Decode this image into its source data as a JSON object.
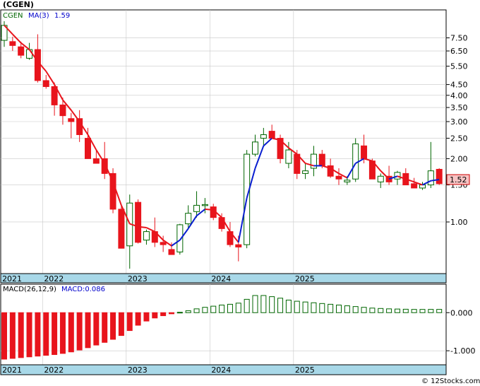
{
  "chart_data": [
    {
      "type": "candlestick",
      "title": "(CGEN)",
      "ticker_label": "CGEN",
      "ma_label": "MA(3)",
      "ma_value": "1.59",
      "last_price": "1.52",
      "y_scale": "log",
      "ylim": [
        0.6,
        9.0
      ],
      "y_ticks": [
        7.5,
        6.5,
        5.5,
        4.5,
        4.0,
        3.5,
        3.0,
        2.5,
        2.0,
        1.5,
        1.0
      ],
      "y_tick_labels": [
        "7.50",
        "6.50",
        "5.50",
        "4.50",
        "4.00",
        "3.50",
        "3.00",
        "2.50",
        "2.00",
        "1.50",
        "1.00"
      ],
      "x_labels": [
        "2021",
        "2022",
        "2023",
        "2024",
        "2025"
      ],
      "x_label_index": [
        0,
        5,
        15,
        25,
        35
      ],
      "ohlc": [
        [
          7.3,
          9.0,
          6.8,
          8.6
        ],
        [
          7.2,
          7.6,
          6.5,
          6.9
        ],
        [
          6.8,
          7.2,
          6.0,
          6.2
        ],
        [
          6.0,
          7.1,
          5.9,
          6.6
        ],
        [
          6.6,
          7.8,
          4.6,
          4.7
        ],
        [
          4.7,
          5.0,
          4.3,
          4.4
        ],
        [
          4.4,
          4.6,
          3.2,
          3.6
        ],
        [
          3.6,
          3.9,
          2.9,
          3.2
        ],
        [
          3.1,
          3.3,
          2.5,
          3.0
        ],
        [
          3.1,
          3.4,
          2.4,
          2.6
        ],
        [
          2.5,
          2.8,
          2.0,
          2.0
        ],
        [
          2.0,
          2.2,
          1.9,
          1.9
        ],
        [
          2.0,
          2.4,
          1.6,
          1.7
        ],
        [
          1.7,
          1.8,
          1.1,
          1.15
        ],
        [
          1.15,
          1.2,
          0.75,
          0.75
        ],
        [
          0.77,
          1.35,
          0.6,
          1.23
        ],
        [
          1.24,
          1.28,
          0.79,
          0.8
        ],
        [
          0.82,
          0.92,
          0.78,
          0.9
        ],
        [
          0.9,
          1.05,
          0.76,
          0.8
        ],
        [
          0.8,
          0.86,
          0.72,
          0.78
        ],
        [
          0.74,
          0.8,
          0.7,
          0.7
        ],
        [
          0.72,
          0.98,
          0.7,
          0.97
        ],
        [
          0.98,
          1.2,
          0.93,
          1.1
        ],
        [
          1.12,
          1.4,
          1.05,
          1.2
        ],
        [
          1.2,
          1.3,
          1.1,
          1.21
        ],
        [
          1.18,
          1.22,
          1.02,
          1.05
        ],
        [
          1.05,
          1.1,
          0.9,
          0.93
        ],
        [
          0.9,
          1.0,
          0.76,
          0.78
        ],
        [
          0.78,
          0.86,
          0.65,
          0.76
        ],
        [
          0.78,
          2.2,
          0.75,
          2.1
        ],
        [
          2.1,
          2.6,
          2.05,
          2.4
        ],
        [
          2.5,
          2.8,
          2.3,
          2.6
        ],
        [
          2.7,
          2.9,
          2.6,
          2.5
        ],
        [
          2.5,
          2.6,
          1.9,
          2.0
        ],
        [
          1.9,
          2.4,
          1.8,
          2.2
        ],
        [
          2.1,
          2.2,
          1.6,
          1.7
        ],
        [
          1.7,
          1.9,
          1.6,
          1.75
        ],
        [
          1.8,
          2.3,
          1.65,
          2.1
        ],
        [
          2.1,
          2.2,
          1.8,
          1.85
        ],
        [
          1.85,
          2.0,
          1.62,
          1.65
        ],
        [
          1.65,
          1.8,
          1.5,
          1.6
        ],
        [
          1.55,
          1.65,
          1.5,
          1.58
        ],
        [
          1.6,
          2.5,
          1.55,
          2.35
        ],
        [
          2.3,
          2.6,
          1.9,
          2.0
        ],
        [
          1.95,
          2.0,
          1.6,
          1.6
        ],
        [
          1.55,
          1.7,
          1.45,
          1.65
        ],
        [
          1.65,
          1.85,
          1.5,
          1.55
        ],
        [
          1.6,
          1.75,
          1.5,
          1.72
        ],
        [
          1.7,
          1.8,
          1.55,
          1.5
        ],
        [
          1.52,
          1.62,
          1.48,
          1.45
        ],
        [
          1.45,
          1.55,
          1.42,
          1.5
        ],
        [
          1.5,
          2.4,
          1.45,
          1.75
        ],
        [
          1.78,
          1.8,
          1.5,
          1.52
        ]
      ],
      "ma3": [
        8.6,
        7.8,
        7.1,
        6.6,
        5.8,
        5.2,
        4.5,
        3.8,
        3.4,
        3.0,
        2.6,
        2.2,
        1.9,
        1.55,
        1.2,
        0.98,
        0.95,
        0.94,
        0.9,
        0.82,
        0.77,
        0.82,
        0.93,
        1.07,
        1.15,
        1.14,
        1.05,
        0.9,
        0.8,
        1.3,
        1.8,
        2.3,
        2.5,
        2.45,
        2.25,
        2.1,
        1.9,
        1.85,
        1.85,
        1.8,
        1.7,
        1.62,
        1.9,
        2.0,
        1.95,
        1.75,
        1.6,
        1.65,
        1.6,
        1.55,
        1.5,
        1.57,
        1.59
      ]
    },
    {
      "type": "bar",
      "title": "MACD(26,12,9)",
      "value_label": "MACD:0.086",
      "y_ticks": [
        0.0,
        -1.0
      ],
      "y_tick_labels": [
        "0.000",
        "-1.000"
      ],
      "ylim": [
        -1.22,
        0.45
      ],
      "x_labels": [
        "2021",
        "2022",
        "2023",
        "2024",
        "2025"
      ],
      "values": [
        -1.22,
        -1.2,
        -1.18,
        -1.16,
        -1.14,
        -1.12,
        -1.1,
        -1.07,
        -1.03,
        -0.98,
        -0.92,
        -0.85,
        -0.78,
        -0.7,
        -0.6,
        -0.47,
        -0.33,
        -0.22,
        -0.14,
        -0.08,
        -0.03,
        0.01,
        0.05,
        0.1,
        0.14,
        0.17,
        0.2,
        0.22,
        0.25,
        0.35,
        0.45,
        0.45,
        0.42,
        0.38,
        0.33,
        0.3,
        0.28,
        0.26,
        0.24,
        0.22,
        0.2,
        0.18,
        0.16,
        0.14,
        0.12,
        0.11,
        0.1,
        0.095,
        0.09,
        0.085,
        0.085,
        0.086,
        0.086
      ]
    }
  ],
  "watermark": "© 12Stocks.com",
  "colors": {
    "up_candle_fill": "#ffffff",
    "up_candle_stroke": "#006600",
    "down_candle": "#e8141c",
    "ma_down": "#e8141c",
    "ma_up": "#0a1fd0",
    "axis_band": "#a8d8e8",
    "macd_negative": "#e8141c",
    "macd_positive": "#006600",
    "grid": "#c8c8c8",
    "last_price_box": "#f6c3c3"
  }
}
